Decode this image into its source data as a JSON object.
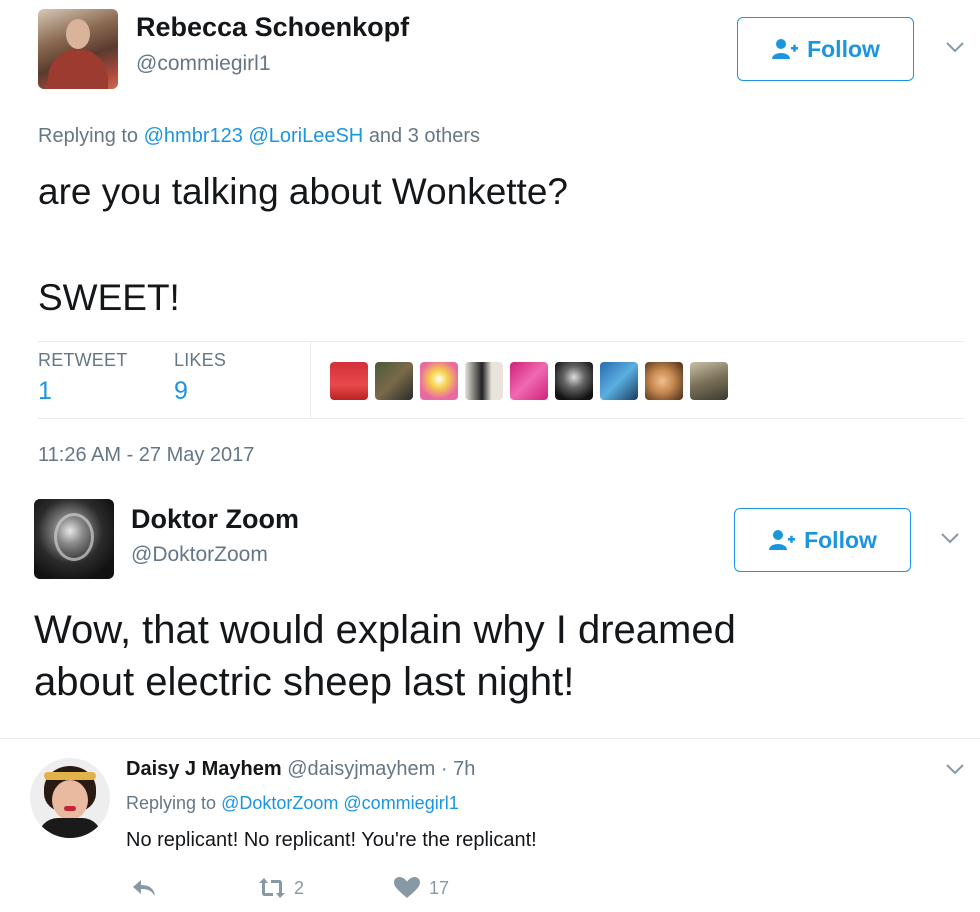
{
  "tweet1": {
    "name": "Rebecca Schoenkopf",
    "handle": "@commiegirl1",
    "follow_label": "Follow",
    "replying_prefix": "Replying to",
    "mention_1": "@hmbr123",
    "mention_2": "@LoriLeeSH",
    "replying_suffix": "and 3 others",
    "text_line1": "are you talking about Wonkette?",
    "text_line2": "SWEET!",
    "retweet_label": "RETWEET",
    "retweet_count": "1",
    "likes_label": "LIKES",
    "likes_count": "9",
    "timestamp": "11:26 AM - 27 May 2017"
  },
  "tweet2": {
    "name": "Doktor Zoom",
    "handle": "@DoktorZoom",
    "follow_label": "Follow",
    "text_line1": "Wow, that would explain why I dreamed",
    "text_line2": "about electric sheep last night!"
  },
  "reply": {
    "name": "Daisy J Mayhem",
    "handle": "@daisyjmayhem",
    "time": "· 7h",
    "replying_prefix": "Replying to",
    "mention_1": "@DoktorZoom",
    "mention_2": "@commiegirl1",
    "text": "No replicant! No replicant! You're the replicant!",
    "retweet_count": "2",
    "like_count": "17"
  },
  "icons": {
    "follow": "add-user-icon",
    "chevron": "chevron-down-icon",
    "reply": "reply-icon",
    "retweet": "retweet-icon",
    "like": "heart-icon"
  },
  "colors": {
    "accent": "#1b95e0",
    "muted": "#657786",
    "text": "#14171a",
    "border": "#e6ecf0"
  }
}
